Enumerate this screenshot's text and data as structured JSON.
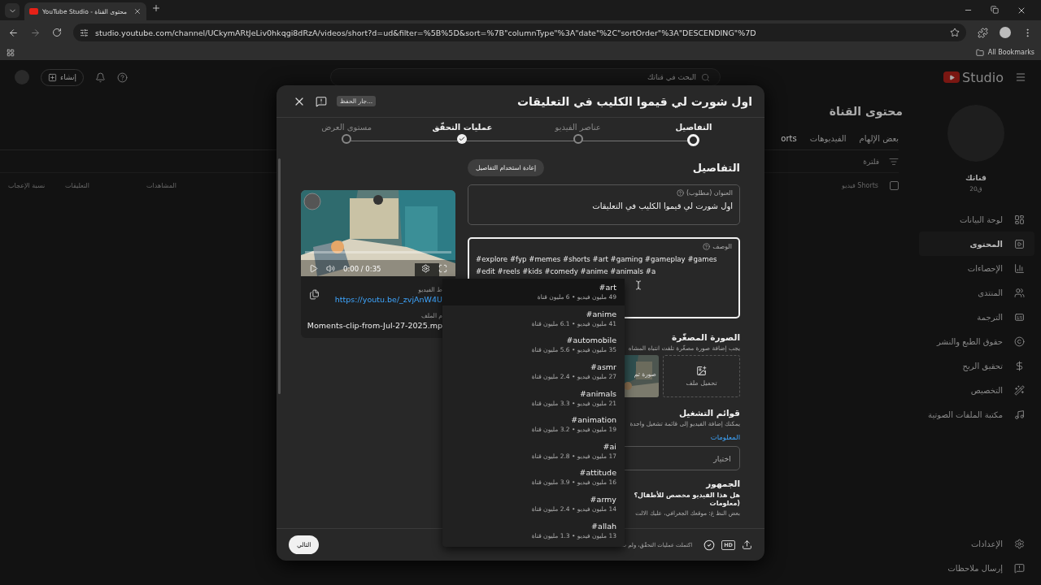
{
  "browser": {
    "tab_title": "YouTube Studio - محتوى القناة",
    "url": "studio.youtube.com/channel/UCkymARtJeLiv0hkqgi8dRzA/videos/short?d=ud&filter=%5B%5D&sort=%7B\"columnType\"%3A\"date\"%2C\"sortOrder\"%3A\"DESCENDING\"%7D",
    "bookmarks": "All Bookmarks"
  },
  "header": {
    "create": "إنشاء",
    "search_placeholder": "البحث في قناتك",
    "logo": "Studio"
  },
  "content": {
    "title": "محتوى القناة",
    "tabs": [
      {
        "label": "بعض الإلهام",
        "selected": false
      },
      {
        "label": "الفيديوهات",
        "selected": false
      },
      {
        "label": "orts",
        "selected": true
      }
    ],
    "filter_placeholder": "فلترة",
    "select_all_checked": false,
    "columns": [
      "فيديو Shorts",
      "المشاهدات",
      "التعليقات",
      "نسبة الإعجاب"
    ]
  },
  "sidebar": {
    "channel_name": "قناتك",
    "channel_meta": "20ق",
    "items": [
      {
        "label": "لوحة البيانات",
        "selected": false
      },
      {
        "label": "المحتوى",
        "selected": true
      },
      {
        "label": "الإحصاءات",
        "selected": false
      },
      {
        "label": "المنتدى",
        "selected": false
      },
      {
        "label": "الترجمة",
        "selected": false
      },
      {
        "label": "حقوق الطبع والنشر",
        "selected": false
      },
      {
        "label": "تحقيق الربح",
        "selected": false
      },
      {
        "label": "التخصيص",
        "selected": false
      },
      {
        "label": "مكتبة الملفات الصوتية",
        "selected": false
      }
    ],
    "bottom_items": [
      "الإعدادات",
      "إرسال ملاحظات"
    ]
  },
  "modal": {
    "title": "اول شورت لي قيموا الكليب في التعليقات",
    "saving": "جار الحفظ...",
    "steps": [
      {
        "label": "التفاصيل",
        "selected": true,
        "done": false
      },
      {
        "label": "عناصر الفيديو",
        "selected": false,
        "done": false
      },
      {
        "label": "عمليات التحقّق",
        "selected": false,
        "done": true
      },
      {
        "label": "مستوى العرض",
        "selected": false,
        "done": false
      }
    ],
    "section_title": "التفاصيل",
    "reuse_button": "إعادة استخدام التفاصيل",
    "title_field": {
      "label": "العنوان (مطلوب)",
      "value": "اول شورت لي قيموا الكليب في التعليقات"
    },
    "description_field": {
      "label": "الوصف",
      "value": "#explore #fyp #memes #shorts #art #gaming #gameplay #games #edit #reels #kids #comedy #anime #animals #a",
      "focused": true
    },
    "video": {
      "time": "0:00 / 0:35",
      "link_label": "ط الفيديو",
      "link": "https://youtu.be/_zvjAnW4U",
      "file_label": "م الملف",
      "file_name": "Moments-clip-from-Jul-27-2025.mp"
    },
    "thumbnail": {
      "title": "الصورة المصغّرة",
      "hint": "يجب إضافة صورة مصغّرة تلفت انتباه المشاه",
      "upload": "تحميل ملف",
      "auto_label": "صورة تم"
    },
    "playlists": {
      "title": "قوائم التشغيل",
      "hint": "يمكنك إضافة الفيديو إلى قائمة تشغيل واحدة",
      "link": "المعلومات",
      "select_placeholder": "اختيار"
    },
    "audience": {
      "title": "الجمهور",
      "question": "هل هذا الفيديو مخصص للأطفال؟ (معلومات",
      "note": "بعض النظ غ: موقعك الجغرافي، عليك الالت"
    },
    "footer": {
      "next": "التالي",
      "status": "اكتملت عمليات التحقّق، ولم ت",
      "hd": "HD"
    }
  },
  "suggestions": [
    {
      "tag": "#art",
      "stats": "49 مليون فيديو • 6 مليون قناة",
      "selected": true
    },
    {
      "tag": "#anime",
      "stats": "41 مليون فيديو • 6.1 مليون قناة",
      "selected": false
    },
    {
      "tag": "#automobile",
      "stats": "35 مليون فيديو • 5.6 مليون قناة",
      "selected": false
    },
    {
      "tag": "#asmr",
      "stats": "27 مليون فيديو • 2.4 مليون قناة",
      "selected": false
    },
    {
      "tag": "#animals",
      "stats": "21 مليون فيديو • 3.3 مليون قناة",
      "selected": false
    },
    {
      "tag": "#animation",
      "stats": "19 مليون فيديو • 3.2 مليون قناة",
      "selected": false
    },
    {
      "tag": "#ai",
      "stats": "17 مليون فيديو • 2.8 مليون قناة",
      "selected": false
    },
    {
      "tag": "#attitude",
      "stats": "16 مليون فيديو • 3.9 مليون قناة",
      "selected": false
    },
    {
      "tag": "#army",
      "stats": "14 مليون فيديو • 2.4 مليون قناة",
      "selected": false
    },
    {
      "tag": "#allah",
      "stats": "13 مليون فيديو • 1.3 مليون قناة",
      "selected": false
    }
  ]
}
